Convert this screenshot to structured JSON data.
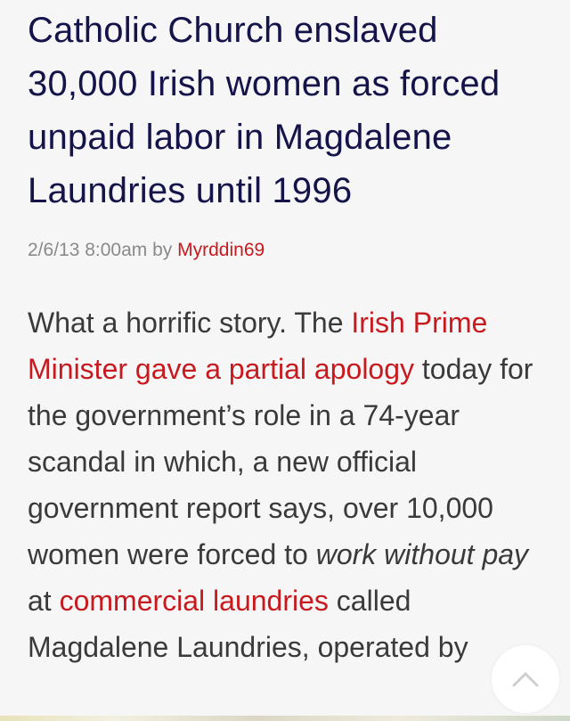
{
  "article": {
    "headline": "Catholic Church enslaved 30,000 Irish women as forced unpaid labor in Magdalene Laundries until 1996",
    "meta": {
      "date": "2/6/13 8:00am",
      "by": "by",
      "author": "Myrddin69"
    },
    "body": {
      "s1": "What a horrific story.  The ",
      "link1": "Irish Prime Minister gave a partial apology",
      "s2": " today for the government’s role in a 74-year scandal in which, a new official government report says, over 10,000 women were forced to ",
      "em1": "work without pay",
      "s3": " at ",
      "link2": "commercial laundries",
      "s4": " called Magdalene Laundries, operated by"
    }
  },
  "ui": {
    "scroll_top_icon": "chevron-up-icon",
    "accent_color": "#c8191e",
    "headline_color": "#14144a"
  }
}
